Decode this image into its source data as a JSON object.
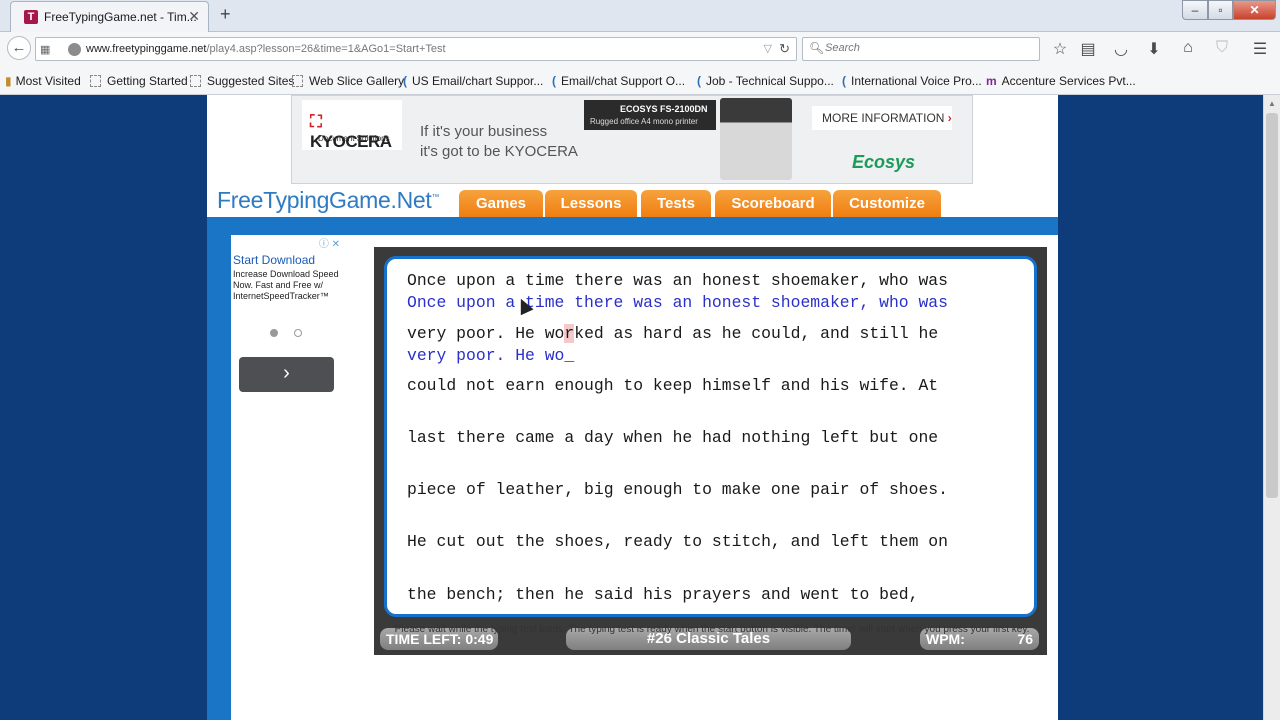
{
  "browser": {
    "tab_title": "FreeTypingGame.net - Tim...",
    "favicon_letter": "T",
    "url_host": "www.freetypinggame.net",
    "url_path": "/play4.asp?lesson=26&time=1&AGo1=Start+Test",
    "search_placeholder": "Search"
  },
  "bookmarks": [
    "Most Visited",
    "Getting Started",
    "Suggested Sites",
    "Web Slice Gallery",
    "US Email/chart Suppor...",
    "Email/chat Support O...",
    "Job - Technical Suppo...",
    "International Voice Pro...",
    "Accenture Services Pvt..."
  ],
  "ad_banner": {
    "brand": "KYOCERA",
    "brand_sub": "Document Solutions",
    "tagline_1": "If it's your business",
    "tagline_2": "it's got to be KYOCERA",
    "model": "ECOSYS FS-2100DN",
    "model_sub": "Rugged office A4 mono printer",
    "cta": "MORE INFORMATION",
    "ecosys": "Ecosys"
  },
  "site": {
    "logo": "FreeTypingGame.Net",
    "logo_tm": "™",
    "nav": [
      "Games",
      "Lessons",
      "Tests",
      "Scoreboard",
      "Customize"
    ]
  },
  "side_ad": {
    "title": "Start Download",
    "body": "Increase Download Speed Now. Fast and Free w/ InternetSpeedTracker™"
  },
  "typing": {
    "lines": [
      "Once upon a time there was an honest shoemaker, who was",
      "very poor. He worked as hard as he could, and still he",
      "could not earn enough to keep himself and his wife. At",
      "last there came a day when he had nothing left but one",
      "piece of leather, big enough to make one pair of shoes.",
      "He cut out the shoes, ready to stitch, and left them on",
      "the bench; then he said his prayers and went to bed,"
    ],
    "typed_1": "Once upon a time there was an honest shoemaker, who was",
    "typed_2": "very poor. He wo_",
    "line2_before": "very poor. He wo",
    "line2_current": "r",
    "line2_after": "ked as hard as he could, and still he"
  },
  "status": {
    "time_left_label": "TIME LEFT:",
    "time_left": "0:49",
    "lesson": "#26 Classic Tales",
    "wpm_label": "WPM:",
    "wpm": "76"
  },
  "loading_note": "Please wait while the typing test loads. The typing test is ready when the start button is visible. The timer will start when you press your first key."
}
